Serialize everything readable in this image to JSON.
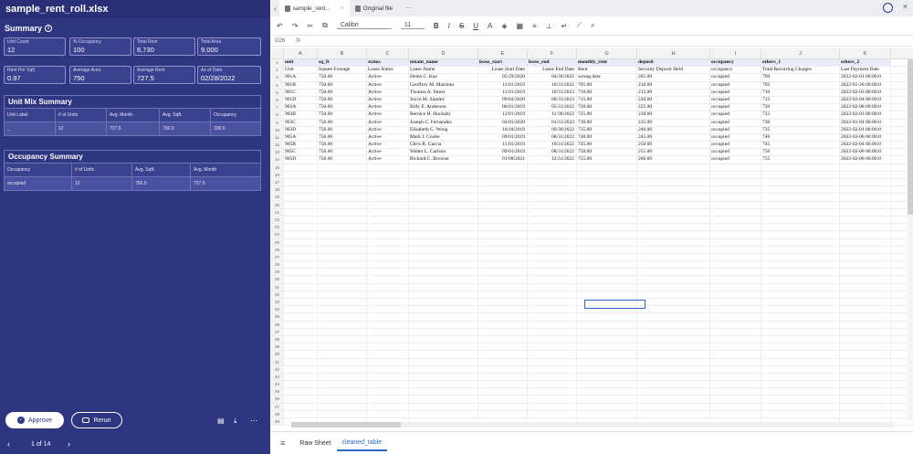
{
  "left": {
    "filename": "sample_rent_roll.xlsx",
    "summary_title": "Summary",
    "cards": [
      {
        "label": "Unit Count",
        "value": "12"
      },
      {
        "label": "% Occupancy",
        "value": "100"
      },
      {
        "label": "Total Rent",
        "value": "8,730"
      },
      {
        "label": "Total Area",
        "value": "9,000"
      },
      {
        "label": "Rent Per Sqft",
        "value": "0.97"
      },
      {
        "label": "Average Area",
        "value": "750"
      },
      {
        "label": "Average Rent",
        "value": "727.5"
      },
      {
        "label": "As of Date",
        "value": "02/28/2022"
      }
    ],
    "unit_mix": {
      "title": "Unit Mix Summary",
      "headers": [
        "Unit Label",
        "# of Units",
        "Avg. Month",
        "Avg. Sqft.",
        "Occupancy"
      ],
      "row": [
        "_",
        "12",
        "727.5",
        "750.0",
        "100.0"
      ]
    },
    "occupancy": {
      "title": "Occupancy Summary",
      "headers": [
        "Occupancy",
        "# of Units",
        "Avg. Sqft.",
        "Avg. Month"
      ],
      "row": [
        "occupied",
        "12",
        "750.0",
        "727.5"
      ]
    },
    "approve_label": "Approve",
    "rerun_label": "Rerun",
    "pager_text": "1 of 14"
  },
  "right": {
    "tabs": [
      "sample_rent...",
      "Original file"
    ],
    "font_name": "Calibri",
    "font_size": "11",
    "cell_ref": "G26",
    "fx": "fx",
    "columns": [
      "A",
      "B",
      "C",
      "D",
      "E",
      "F",
      "G",
      "H",
      "I",
      "J",
      "K"
    ],
    "header_row": [
      "unit",
      "sq_ft",
      "status",
      "tenant_name",
      "lease_start",
      "lease_end",
      "monthly_rent",
      "deposit",
      "occupancy",
      "others_1",
      "others_2"
    ],
    "label_row": [
      "Unit",
      "Square Footage",
      "Lease Status",
      "Lease Name",
      "Lease Start Date",
      "Lease End Date",
      "Rent",
      "Security Deposit Held",
      "occupancy",
      "Total Recurring Charges",
      "Last Payment Date"
    ],
    "rows": [
      [
        "901A",
        "750.00",
        "Active",
        "Helen C. Kay",
        "05/29/2020",
        "04/30/2022",
        "wrong data",
        "205.00",
        "occupied",
        "700",
        "2022-02-01 00:00:0"
      ],
      [
        "901B",
        "750.00",
        "Active",
        "Geoffrey M. Martinez",
        "11/01/2019",
        "10/31/2022",
        "705.00",
        "210.00",
        "occupied",
        "705",
        "2022-01-28 00:00:0"
      ],
      [
        "901C",
        "750.00",
        "Active",
        "Thomas A. Street",
        "11/01/2019",
        "10/31/2023",
        "710.00",
        "215.00",
        "occupied",
        "710",
        "2022-02-03 00:00:0"
      ],
      [
        "901D",
        "750.00",
        "Active",
        "Joyce M. Stanley",
        "09/04/2020",
        "08/31/2023",
        "715.00",
        "220.00",
        "occupied",
        "715",
        "2022-02-04 00:00:0"
      ],
      [
        "903A",
        "750.00",
        "Active",
        "Billy E. Anderson",
        "06/01/2019",
        "05/31/2022",
        "720.00",
        "225.00",
        "occupied",
        "720",
        "2022-02-08 00:00:0"
      ],
      [
        "903B",
        "750.00",
        "Active",
        "Bernice H. Huckaby",
        "12/01/2019",
        "11/30/2022",
        "725.00",
        "230.00",
        "occupied",
        "725",
        "2022-02-03 00:00:0"
      ],
      [
        "903C",
        "750.00",
        "Active",
        "Joseph C. Fernandez",
        "02/01/2020",
        "01/31/2023",
        "730.00",
        "235.00",
        "occupied",
        "730",
        "2022-01-04 00:00:0"
      ],
      [
        "903D",
        "750.00",
        "Active",
        "Elizabeth C. Wong",
        "10/18/2019",
        "09/30/2022",
        "735.00",
        "240.00",
        "occupied",
        "735",
        "2022-02-01 00:00:0"
      ],
      [
        "905A",
        "750.00",
        "Active",
        "Mark J. Cooke",
        "09/01/2019",
        "08/31/2022",
        "740.00",
        "245.00",
        "occupied",
        "740",
        "2022-02-08 00:00:0"
      ],
      [
        "905B",
        "750.00",
        "Active",
        "Chris R. Garcia",
        "11/01/2019",
        "10/31/2022",
        "745.00",
        "250.00",
        "occupied",
        "745",
        "2022-02-04 00:00:0"
      ],
      [
        "905C",
        "750.00",
        "Active",
        "Walter L. Carlson",
        "09/01/2019",
        "08/31/2022",
        "750.00",
        "255.00",
        "occupied",
        "750",
        "2022-02-08 00:00:0"
      ],
      [
        "905D",
        "750.00",
        "Active",
        "Richard C. Browne",
        "01/08/2021",
        "12/31/2022",
        "755.00",
        "260.00",
        "occupied",
        "755",
        "2022-02-08 00:00:0"
      ]
    ],
    "sheet_tabs": [
      "Raw Sheet",
      "cleaned_table"
    ]
  }
}
